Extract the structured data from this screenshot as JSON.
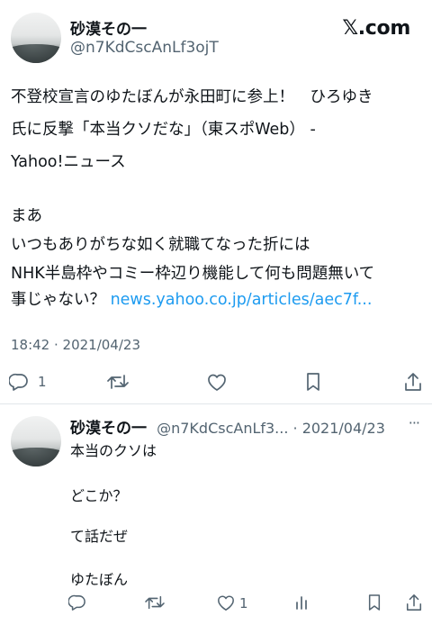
{
  "source_badge": "𝕏.com",
  "main_post": {
    "author_name": "砂漠その一",
    "author_handle": "@n7KdCscAnLf3ojT",
    "text_lines": [
      "不登校宣言のゆたぼんが永田町に参上！　ひろゆき",
      "氏に反撃「本当クソだな」（東スポWeb） -",
      "Yahoo!ニュース",
      "",
      "まあ",
      "いつもありがちな如く就職てなった折には",
      "NHK半島枠やコミー枠辺り機能して何も問題無いて"
    ],
    "last_line_text": "事じゃない？ ",
    "link_text": "news.yahoo.co.jp/articles/aec7f...",
    "timestamp": "18:42 · 2021/04/23",
    "reply_count": "1"
  },
  "reply_post": {
    "author_name": "砂漠その一",
    "handle_and_date": "@n7KdCscAnLf3... · 2021/04/23",
    "more_label": "···",
    "text_lines": [
      "本当のクソは",
      "",
      "どこか？",
      "",
      "て話だぜ",
      "",
      "ゆたぼん"
    ],
    "like_count": "1"
  },
  "icons": {
    "reply": "reply-icon",
    "retweet": "retweet-icon",
    "like": "heart-icon",
    "bookmark": "bookmark-icon",
    "share": "share-icon",
    "views": "views-icon"
  },
  "colors": {
    "text": "#0f1419",
    "secondary": "#536471",
    "link": "#1d9bf0",
    "divider": "#e1e6ea"
  }
}
